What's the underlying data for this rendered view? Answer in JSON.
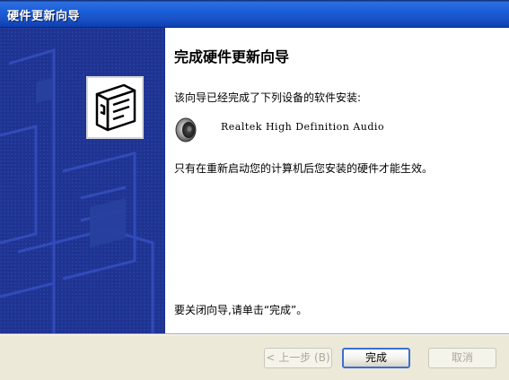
{
  "window": {
    "title": "硬件更新向导"
  },
  "content": {
    "heading": "完成硬件更新向导",
    "intro": "该向导已经完成了下列设备的软件安装:",
    "device": {
      "name": "Realtek High Definition Audio",
      "icon": "speaker-icon"
    },
    "note": "只有在重新启动您的计算机后您安装的硬件才能生效。",
    "close_hint": "要关闭向导,请单击“完成”。"
  },
  "buttons": {
    "back": "< 上一步 (B)",
    "finish": "完成",
    "cancel": "取消"
  },
  "colors": {
    "titlebar": "#1a5fd8",
    "banner": "#1f3391",
    "content_bg": "#ffffff",
    "dialog_bg": "#ece9d8"
  }
}
